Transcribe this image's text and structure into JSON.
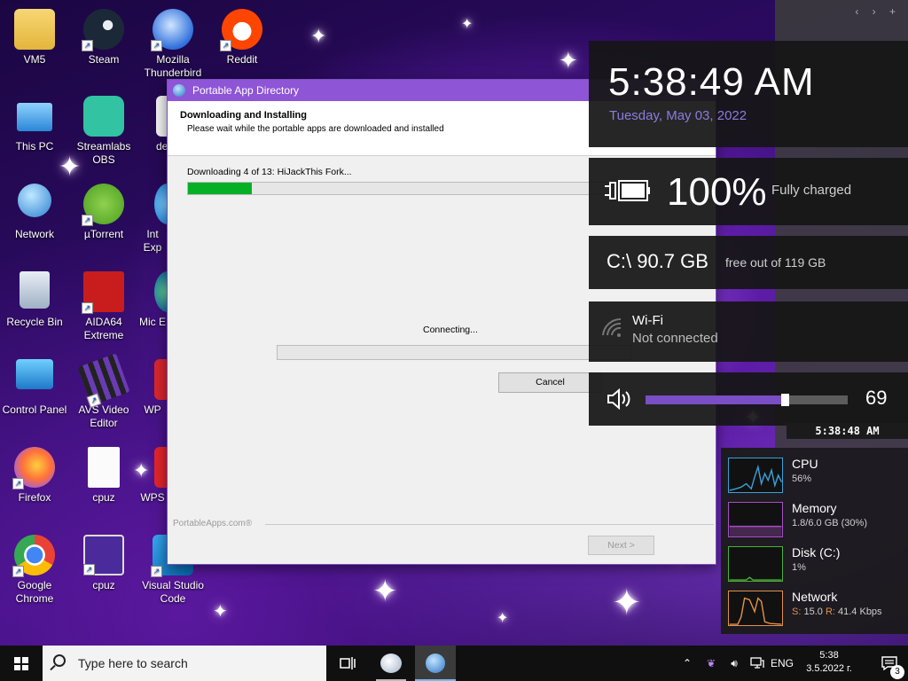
{
  "desktop": {
    "icons": [
      {
        "label": "VM5"
      },
      {
        "label": "Steam"
      },
      {
        "label": "Mozilla Thunderbird"
      },
      {
        "label": "Reddit"
      },
      {
        "label": "This PC"
      },
      {
        "label": "Streamlabs OBS"
      },
      {
        "label": "de"
      },
      {
        "label": "Network"
      },
      {
        "label": "µTorrent"
      },
      {
        "label": "Int Exp"
      },
      {
        "label": "Recycle Bin"
      },
      {
        "label": "AIDA64 Extreme"
      },
      {
        "label": "Mic E"
      },
      {
        "label": "Control Panel"
      },
      {
        "label": "AVS Video Editor"
      },
      {
        "label": "WP"
      },
      {
        "label": "Firefox"
      },
      {
        "label": "cpuz"
      },
      {
        "label": "WPS"
      },
      {
        "label": "Google Chrome"
      },
      {
        "label": "cpuz"
      },
      {
        "label": "Visual Studio Code"
      }
    ]
  },
  "dialog": {
    "title": "Portable App Directory",
    "heading": "Downloading and Installing",
    "subheading": "Please wait while the portable apps are downloaded and installed",
    "download_status": "Downloading 4 of 13: HiJackThis Fork...",
    "download_progress": 0.15,
    "connecting_text": "Connecting...",
    "connecting_progress": 0,
    "cancel_label": "Cancel",
    "brand": "PortableApps.com®",
    "next_label": "Next >"
  },
  "gadgets": {
    "clock": {
      "time": "5:38:49 AM",
      "date": "Tuesday, May 03, 2022"
    },
    "battery": {
      "percent": "100%",
      "status": "Fully charged"
    },
    "disk": {
      "drive": "C:\\  90.7 GB",
      "free": "free out of 119 GB"
    },
    "wifi": {
      "name": "Wi-Fi",
      "status": "Not connected"
    },
    "volume": {
      "value": "69",
      "level": 0.69
    },
    "mini_clock": "5:38:48 AM",
    "colors": {
      "accent": "#8d7be0",
      "volume_fill": "#7a4ec5"
    }
  },
  "performance": {
    "cpu": {
      "name": "CPU",
      "value": "56%",
      "color": "#3aa0d8"
    },
    "memory": {
      "name": "Memory",
      "value": "1.8/6.0 GB (30%)",
      "color": "#a54fc4"
    },
    "disk": {
      "name": "Disk (C:)",
      "value": "1%",
      "color": "#4caf3a"
    },
    "network": {
      "name": "Network",
      "s_label": "S:",
      "s_value": "15.0",
      "r_label": "R:",
      "r_value": "41.4 Kbps",
      "color": "#e0904a"
    }
  },
  "taskbar": {
    "search_placeholder": "Type here to search",
    "language": "ENG",
    "time": "5:38",
    "date": "3.5.2022 г.",
    "notification_count": "3"
  }
}
